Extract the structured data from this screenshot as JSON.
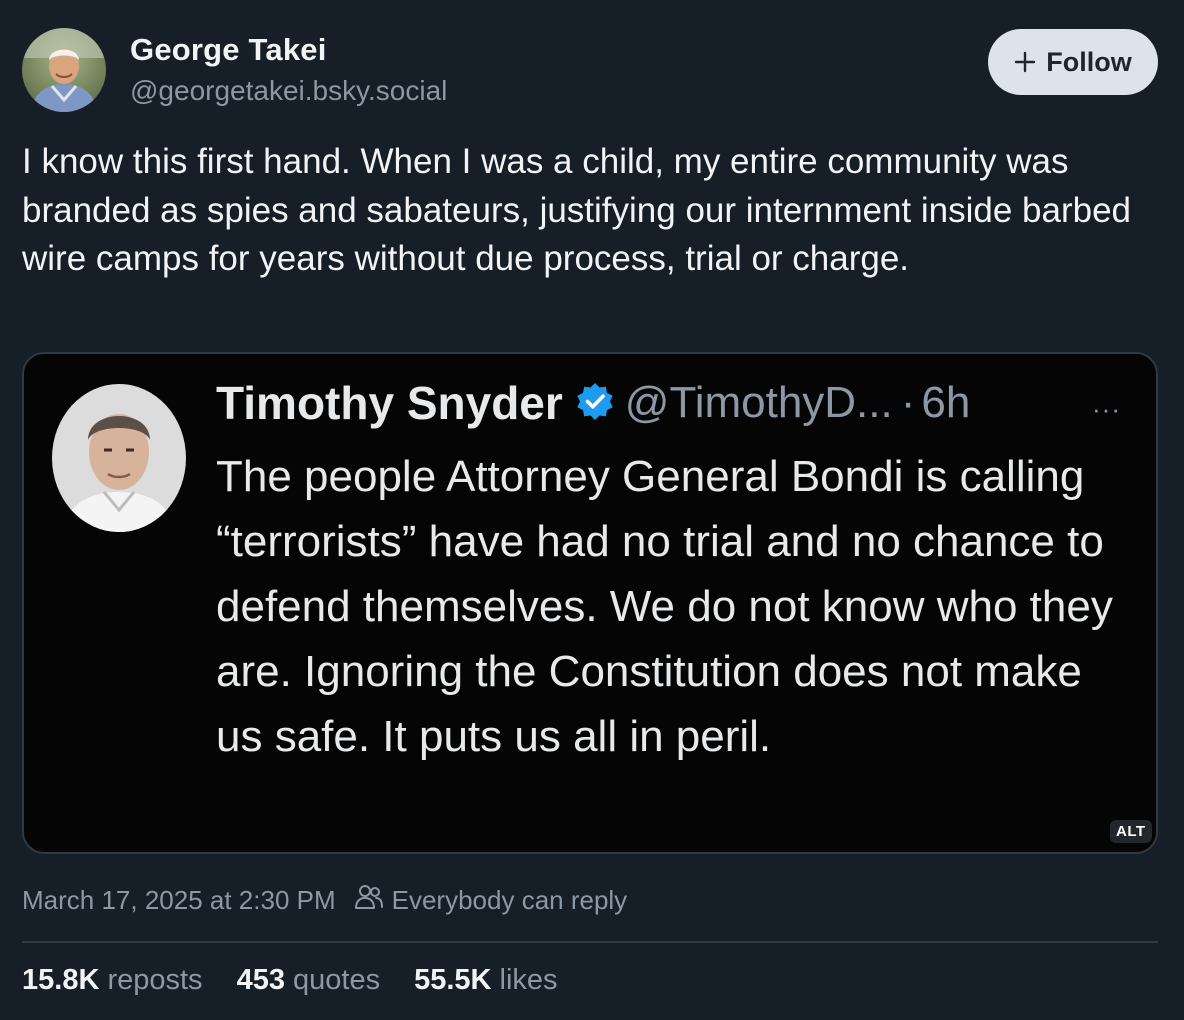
{
  "author": {
    "name": "George Takei",
    "handle": "@georgetakei.bsky.social"
  },
  "follow_button": {
    "label": "Follow"
  },
  "post": {
    "text": "I know this first hand. When I was a child, my entire community was branded as spies and sabateurs, justifying our internment inside barbed wire camps for years without due process, trial or charge."
  },
  "embed": {
    "tweet_name": "Timothy Snyder",
    "tweet_handle": "@TimothyD...",
    "tweet_separator": "·",
    "tweet_time": "6h",
    "tweet_more": "···",
    "tweet_text": "The people Attorney General Bondi is calling “terrorists” have had no trial and no chance to defend themselves. We do not know who they are. Ignoring the Constitution does not make us safe. It puts us all in peril.",
    "alt_badge": "ALT"
  },
  "meta": {
    "timestamp": "March 17, 2025 at 2:30 PM",
    "reply_setting": "Everybody can reply"
  },
  "stats": [
    {
      "count": "15.8K",
      "label": "reposts"
    },
    {
      "count": "453",
      "label": "quotes"
    },
    {
      "count": "55.5K",
      "label": "likes"
    }
  ],
  "colors": {
    "background": "#161e27",
    "text": "#f1f3f5",
    "muted": "#8b98a5",
    "follow_bg": "#dde3ea",
    "verified": "#1d9bf0"
  },
  "icons": [
    "plus-icon",
    "verified-badge-icon",
    "more-icon",
    "people-icon"
  ]
}
